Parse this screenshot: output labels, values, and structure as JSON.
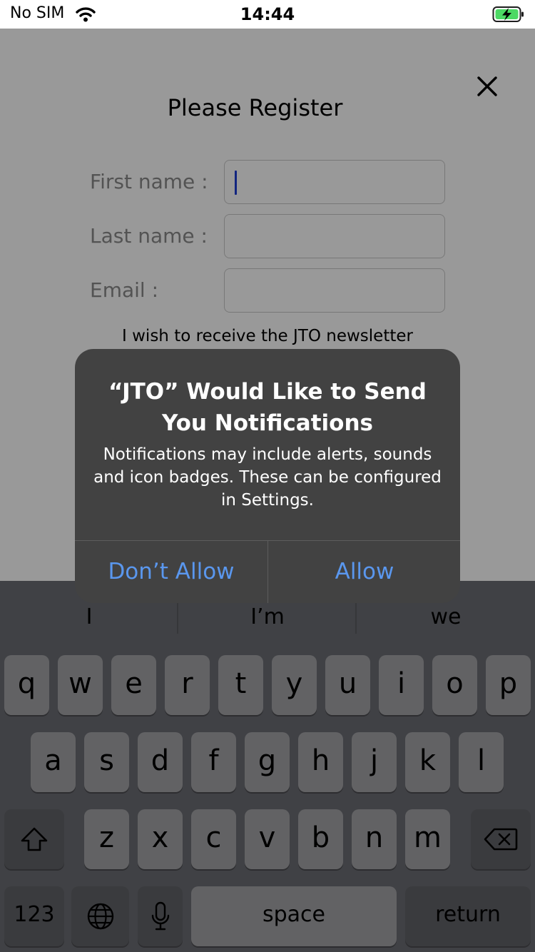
{
  "status_bar": {
    "carrier": "No SIM",
    "time": "14:44"
  },
  "form": {
    "title": "Please Register",
    "first_name_label": "First name :",
    "last_name_label": "Last name :",
    "email_label": "Email :",
    "first_name_value": "",
    "last_name_value": "",
    "email_value": "",
    "newsletter_text": "I wish to receive the JTO newsletter"
  },
  "alert": {
    "title": "“JTO” Would Like to Send You Notifications",
    "message": "Notifications may include alerts, sounds and icon badges. These can be configured in Settings.",
    "deny_label": "Don’t Allow",
    "allow_label": "Allow",
    "button_color": "#5a97ee"
  },
  "keyboard": {
    "suggestions": [
      "I",
      "I’m",
      "we"
    ],
    "row1": [
      "q",
      "w",
      "e",
      "r",
      "t",
      "y",
      "u",
      "i",
      "o",
      "p"
    ],
    "row2": [
      "a",
      "s",
      "d",
      "f",
      "g",
      "h",
      "j",
      "k",
      "l"
    ],
    "row3": [
      "z",
      "x",
      "c",
      "v",
      "b",
      "n",
      "m"
    ],
    "numbers_label": "123",
    "space_label": "space",
    "return_label": "return",
    "icons": {
      "shift": "shift-icon",
      "delete": "delete-icon",
      "globe": "globe-icon",
      "mic": "mic-icon"
    }
  }
}
